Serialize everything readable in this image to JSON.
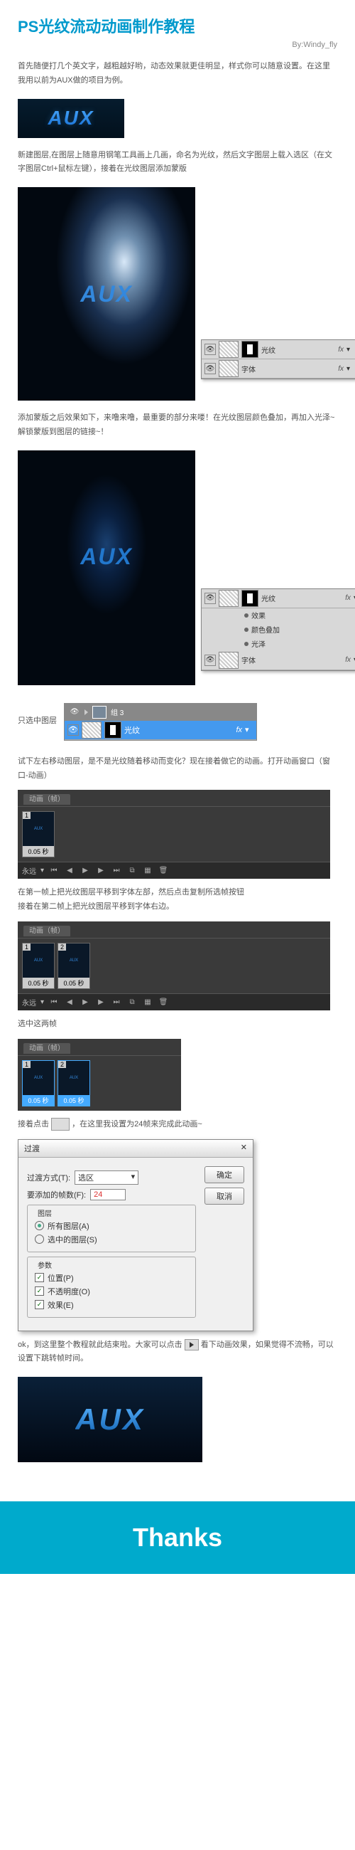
{
  "header": {
    "title": "PS光纹流动动画制作教程",
    "author": "By:Windy_fly"
  },
  "para1": "首先随便打几个英文字，越粗越好哟，动态效果就更佳明显，样式你可以随意设置。在这里我用以前为AUX做的项目为例。",
  "logo": "AUX",
  "para2": "新建图层,在图层上随意用钢笔工具画上几画，命名为光纹，然后文字图层上载入选区（在文字图层Ctrl+鼠标左键），接着在光纹图层添加蒙版",
  "layers1": {
    "r1": "光纹",
    "r2": "字体",
    "fx": "fx"
  },
  "para3": "添加蒙版之后效果如下，来噜来噜，最重要的部分来喽！在光纹图层颜色叠加，再加入光泽~  解锁蒙版到图层的链接~！",
  "layers2": {
    "r1": "光纹",
    "sub1": "效果",
    "sub2": "颜色叠加",
    "sub3": "光泽",
    "r2": "字体"
  },
  "para4": "只选中图层",
  "group": {
    "name": "组 3",
    "layer": "光纹"
  },
  "para5": "试下左右移动图层，是不是光纹随着移动而变化？现在接着做它的动画。打开动画窗口（窗口-动画）",
  "anim": {
    "tab": "动画（帧）",
    "dur": "0.05 秒",
    "loop": "永远"
  },
  "para6": "在第一帧上把光纹图层平移到字体左部，然后点击复制所选帧按钮\n接着在第二帧上把光纹图层平移到字体右边。",
  "para7": "选中这两帧",
  "para8a": "接着点击",
  "para8b": "，在这里我设置为24帧来完成此动画~",
  "dialog": {
    "title": "过渡",
    "lbl1": "过渡方式(T):",
    "sel1": "选区",
    "lbl2": "要添加的帧数(F):",
    "val2": "24",
    "ok": "确定",
    "cancel": "取消",
    "grp1": "图层",
    "opt1": "所有图层(A)",
    "opt2": "选中的图层(S)",
    "grp2": "参数",
    "chk1": "位置(P)",
    "chk2": "不透明度(O)",
    "chk3": "效果(E)"
  },
  "para9a": "ok，到这里整个教程就此结束啦。大家可以点击",
  "para9b": "看下动画效果，如果觉得不流畅，可以设置下跳转帧时间。",
  "thanks": "Thanks"
}
